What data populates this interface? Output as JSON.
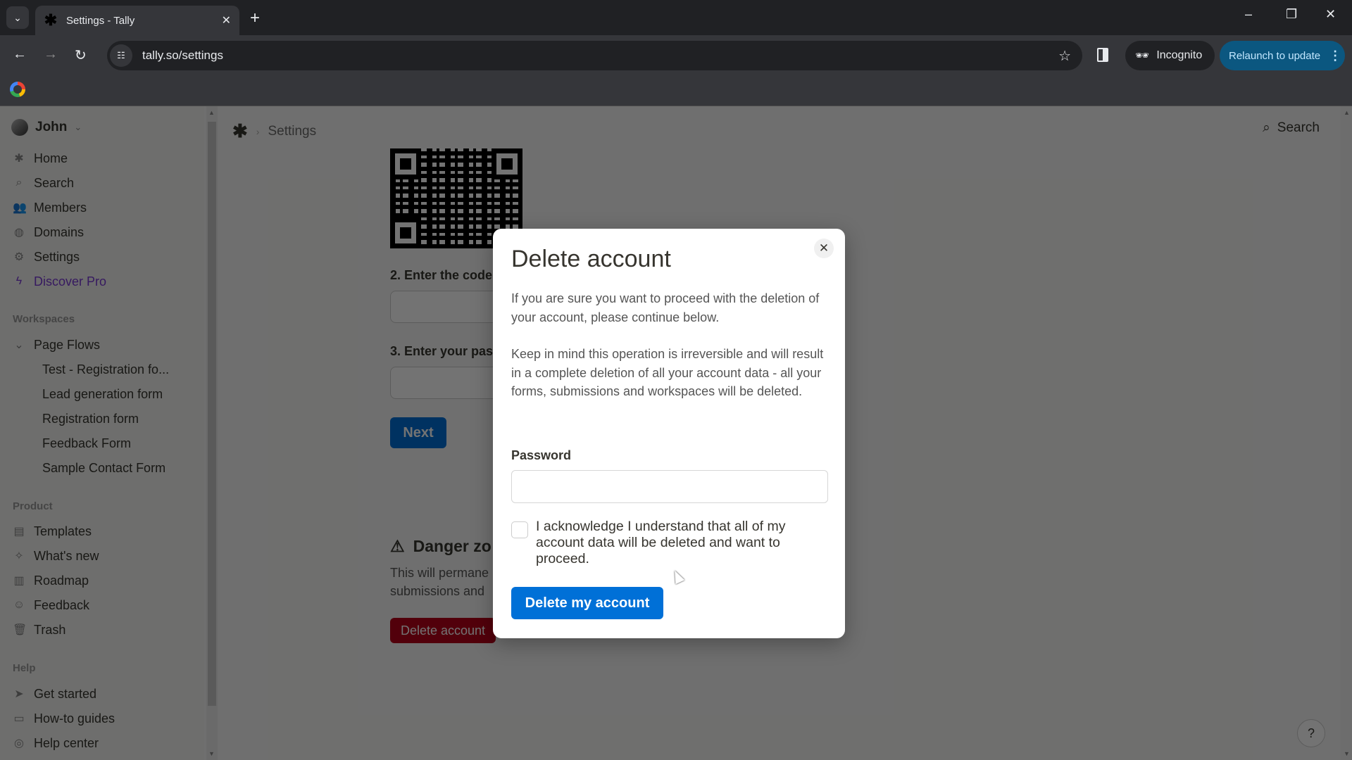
{
  "browser": {
    "tab_title": "Settings - Tally",
    "tab_favicon": "tally-asterisk-icon",
    "url": "tally.so/settings",
    "incognito_label": "Incognito",
    "relaunch_label": "Relaunch to update"
  },
  "sidebar": {
    "user_name": "John",
    "nav": [
      {
        "label": "Home",
        "icon": "asterisk-icon"
      },
      {
        "label": "Search",
        "icon": "search-icon"
      },
      {
        "label": "Members",
        "icon": "users-icon"
      },
      {
        "label": "Domains",
        "icon": "globe-icon"
      },
      {
        "label": "Settings",
        "icon": "gear-icon"
      },
      {
        "label": "Discover Pro",
        "icon": "lightning-icon",
        "accent": "#7a3bd6"
      }
    ],
    "workspaces_heading": "Workspaces",
    "workspace": {
      "name": "Page Flows",
      "forms": [
        "Test - Registration fo...",
        "Lead generation form",
        "Registration form",
        "Feedback Form",
        "Sample Contact Form"
      ]
    },
    "product_heading": "Product",
    "product_items": [
      {
        "label": "Templates",
        "icon": "templates-icon"
      },
      {
        "label": "What's new",
        "icon": "sparkle-icon"
      },
      {
        "label": "Roadmap",
        "icon": "map-icon"
      },
      {
        "label": "Feedback",
        "icon": "smiley-icon"
      },
      {
        "label": "Trash",
        "icon": "trash-icon"
      }
    ],
    "help_heading": "Help",
    "help_items": [
      {
        "label": "Get started",
        "icon": "send-icon"
      },
      {
        "label": "How-to guides",
        "icon": "book-icon"
      },
      {
        "label": "Help center",
        "icon": "lifebuoy-icon"
      }
    ]
  },
  "main": {
    "breadcrumb": "Settings",
    "search_label": "Search",
    "step2_label": "2. Enter the code",
    "step3_label": "3. Enter your pas",
    "next_label": "Next",
    "danger_title": "Danger zo",
    "danger_text_line1": "This will permane",
    "danger_text_line2": "submissions and",
    "delete_account_label": "Delete account",
    "help_label": "?"
  },
  "modal": {
    "title": "Delete account",
    "para1": "If you are sure you want to proceed with the deletion of your account, please continue below.",
    "para2": "Keep in mind this operation is irreversible and will result in a complete deletion of all your account data - all your forms, submissions and workspaces will be deleted.",
    "password_label": "Password",
    "password_value": "",
    "acknowledge_label": "I acknowledge I understand that all of my account data will be deleted and want to proceed.",
    "acknowledge_checked": false,
    "submit_label": "Delete my account",
    "primary_color": "#0070d7"
  }
}
